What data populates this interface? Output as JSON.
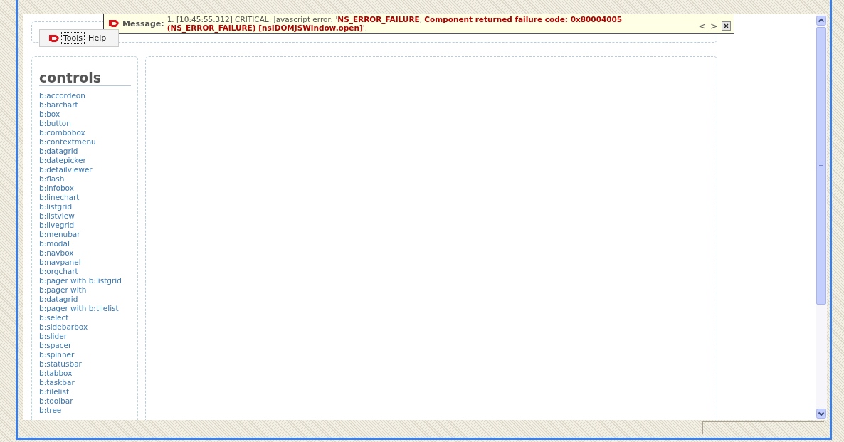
{
  "message_bar": {
    "label": "Message:",
    "parts": [
      {
        "kind": "plain",
        "text": "1. [10:45:55.312] CRITICAL: Javascript error: '"
      },
      {
        "kind": "error",
        "text": "NS_ERROR_FAILURE"
      },
      {
        "kind": "plain",
        "text": ", "
      },
      {
        "kind": "error",
        "text": "Component returned failure code: 0x80004005 (NS_ERROR_FAILURE) [nsIDOMJSWindow.open]"
      },
      {
        "kind": "plain",
        "text": "'."
      }
    ],
    "prev": "<",
    "next": ">"
  },
  "toolbar": {
    "menus": [
      {
        "label": "Tools",
        "selected": true
      },
      {
        "label": "Help",
        "selected": false
      }
    ]
  },
  "sidebar": {
    "heading": "controls",
    "items": [
      "b:accordeon",
      "b:barchart",
      "b:box",
      "b:button",
      "b:combobox",
      "b:contextmenu",
      "b:datagrid",
      "b:datepicker",
      "b:detailviewer",
      "b:flash",
      "b:infobox",
      "b:linechart",
      "b:listgrid",
      "b:listview",
      "b:livegrid",
      "b:menubar",
      "b:modal",
      "b:navbox",
      "b:navpanel",
      "b:orgchart",
      "b:pager with b:listgrid",
      "b:pager with",
      "b:datagrid",
      "b:pager with b:tilelist",
      "b:select",
      "b:sidebarbox",
      "b:slider",
      "b:spacer",
      "b:spinner",
      "b:statusbar",
      "b:tabbox",
      "b:taskbar",
      "b:tilelist",
      "b:toolbar",
      "b:tree"
    ]
  }
}
